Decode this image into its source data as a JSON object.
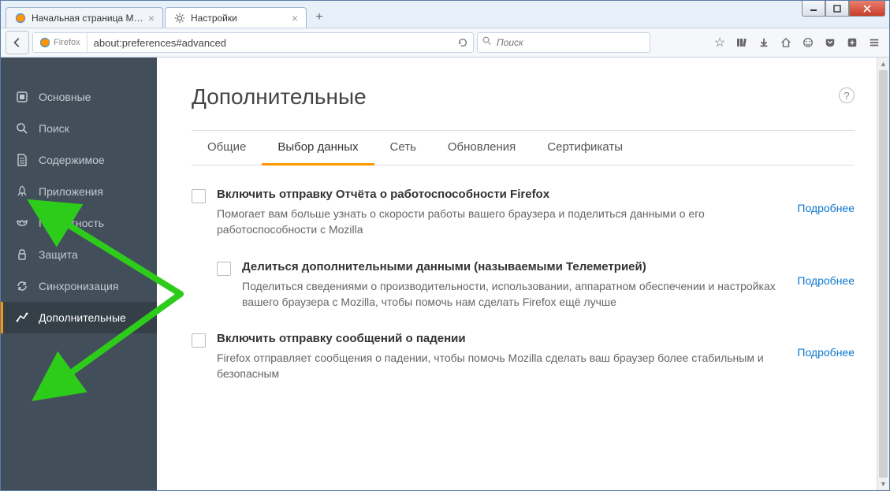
{
  "window": {
    "tabs": [
      {
        "label": "Начальная страница Mozi...",
        "icon": "firefox"
      },
      {
        "label": "Настройки",
        "icon": "gear"
      }
    ]
  },
  "nav": {
    "identity_label": "Firefox",
    "url": "about:preferences#advanced",
    "search_placeholder": "Поиск"
  },
  "sidebar": {
    "items": [
      {
        "label": "Основные"
      },
      {
        "label": "Поиск"
      },
      {
        "label": "Содержимое"
      },
      {
        "label": "Приложения"
      },
      {
        "label": "Приватность"
      },
      {
        "label": "Защита"
      },
      {
        "label": "Синхронизация"
      },
      {
        "label": "Дополнительные"
      }
    ]
  },
  "page": {
    "title": "Дополнительные",
    "subtabs": [
      "Общие",
      "Выбор данных",
      "Сеть",
      "Обновления",
      "Сертификаты"
    ],
    "settings": [
      {
        "title": "Включить отправку Отчёта о работоспособности Firefox",
        "desc": "Помогает вам больше узнать о скорости работы вашего браузера и поделиться данными о его работоспособности с Mozilla",
        "link": "Подробнее"
      },
      {
        "title": "Делиться дополнительными данными (называемыми Телеметрией)",
        "desc": "Поделиться сведениями о производительности, использовании, аппаратном обеспечении и настройках вашего браузера с Mozilla, чтобы помочь нам сделать Firefox ещё лучше",
        "link": "Подробнее"
      },
      {
        "title": "Включить отправку сообщений о падении",
        "desc": "Firefox отправляет сообщения о падении, чтобы помочь Mozilla сделать ваш браузер более стабильным и безопасным",
        "link": "Подробнее"
      }
    ]
  },
  "colors": {
    "accent": "#ff9500",
    "sidebar_bg": "#424f5a",
    "link": "#0b77d0",
    "annotation": "#2ecc1a"
  }
}
